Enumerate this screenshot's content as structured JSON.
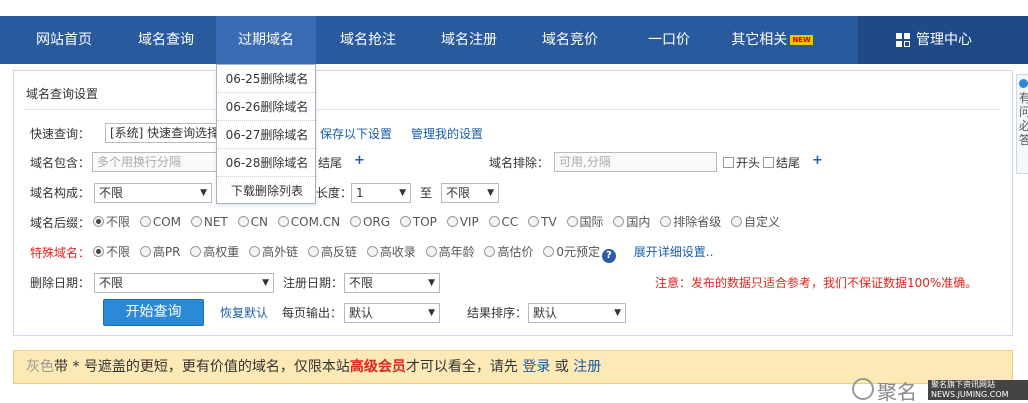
{
  "nav": {
    "items": [
      "网站首页",
      "域名查询",
      "过期域名",
      "域名抢注",
      "域名注册",
      "域名竞价",
      "一口价",
      "其它相关"
    ],
    "new_badge": "NEW",
    "admin_label": "管理中心"
  },
  "dropdown": {
    "items": [
      "06-25删除域名",
      "06-26删除域名",
      "06-27删除域名",
      "06-28删除域名",
      "下载删除列表"
    ]
  },
  "panel": {
    "title": "域名查询设置",
    "quick": {
      "label": "快速查询：",
      "value": "[系统] 快速查询选择",
      "save_link": "保存以下设置",
      "manage_link": "管理我的设置"
    },
    "contains": {
      "label": "域名包含：",
      "placeholder": "多个用换行分隔",
      "end_label": "结尾",
      "plus": "+"
    },
    "exclude": {
      "label": "域名排除：",
      "placeholder": "可用,分隔",
      "start_label": "开头",
      "end_label": "结尾",
      "plus": "+"
    },
    "compose": {
      "label": "域名构成：",
      "value": "不限",
      "length_label": "长度：",
      "length_from": "1",
      "to_label": "至",
      "length_to": "不限"
    },
    "suffix": {
      "label": "域名后缀：",
      "options": [
        "不限",
        "COM",
        "NET",
        "CN",
        "COM.CN",
        "ORG",
        "TOP",
        "VIP",
        "CC",
        "TV",
        "国际",
        "国内",
        "排除省级",
        "自定义"
      ],
      "selected": "不限"
    },
    "special": {
      "label": "特殊域名：",
      "options": [
        "不限",
        "高PR",
        "高权重",
        "高外链",
        "高反链",
        "高收录",
        "高年龄",
        "高估价",
        "0元预定"
      ],
      "selected": "不限",
      "expand_link": "展开详细设置.."
    },
    "delete_date": {
      "label": "删除日期：",
      "value": "不限",
      "reg_label": "注册日期：",
      "reg_value": "不限",
      "notice": "注意：发布的数据只适合参考，我们不保证数据100%准确。"
    },
    "actions": {
      "start_button": "开始查询",
      "reset_link": "恢复默认",
      "per_page_label": "每页输出：",
      "per_page_value": "默认",
      "sort_label": "结果排序：",
      "sort_value": "默认"
    }
  },
  "banner": {
    "part1": "灰色",
    "part2": "带 * 号遮盖的更短，更有价值的域名，仅限本站",
    "part3": "高级会员",
    "part4": "才可以看全，请先 ",
    "login": "登录",
    "part5": " 或 ",
    "register": "注册"
  },
  "side_tab": {
    "text": "有问必答"
  },
  "watermark": {
    "name": "聚名",
    "line1": "聚名旗下资讯网站",
    "line2": "NEWS.JUMING.COM"
  },
  "colors": {
    "nav_bg": "#2a5a9e",
    "admin_bg": "#1f4a87",
    "link": "#1a5ca8",
    "warn": "#e0251f",
    "banner_bg": "#fde9b6",
    "button": "#2a8ad8"
  }
}
